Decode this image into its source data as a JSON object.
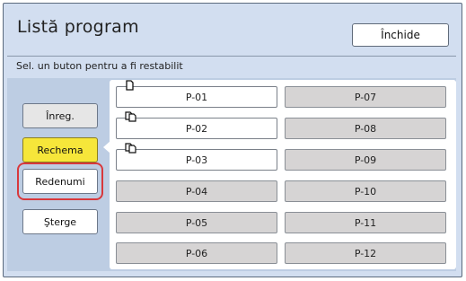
{
  "window": {
    "title": "Listă program",
    "close_label": "Închide"
  },
  "instruction": "Sel. un buton pentru a fi restabilit",
  "side_buttons": [
    {
      "label": "Înreg."
    },
    {
      "label": "Rechema",
      "selected": true
    },
    {
      "label": "Redenumi",
      "highlighted": true
    },
    {
      "label": "Şterge"
    }
  ],
  "programs": [
    {
      "label": "P-01",
      "registered": true,
      "icon": "single-document-icon"
    },
    {
      "label": "P-02",
      "registered": true,
      "icon": "multi-document-icon"
    },
    {
      "label": "P-03",
      "registered": true,
      "icon": "multi-document-icon"
    },
    {
      "label": "P-04"
    },
    {
      "label": "P-05"
    },
    {
      "label": "P-06"
    },
    {
      "label": "P-07"
    },
    {
      "label": "P-08"
    },
    {
      "label": "P-09"
    },
    {
      "label": "P-10"
    },
    {
      "label": "P-11"
    },
    {
      "label": "P-12"
    }
  ],
  "colors": {
    "background": "#d2def0",
    "selected_button": "#f6e63a",
    "highlight_ring": "#d8383c",
    "unregistered_program": "#d6d4d4"
  }
}
